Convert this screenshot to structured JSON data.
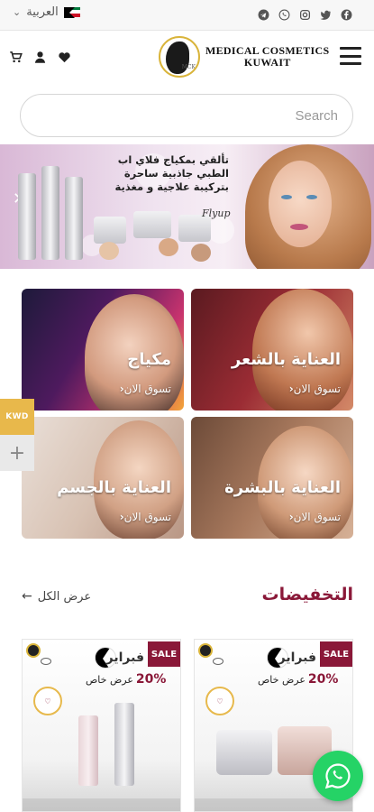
{
  "topbar": {
    "language_label": "العربية",
    "social_icons": [
      "facebook-icon",
      "twitter-icon",
      "instagram-icon",
      "whatsapp-icon",
      "telegram-icon"
    ]
  },
  "header": {
    "logo_line1": "MEDICAL COSMETICS",
    "logo_line2": "KUWAIT",
    "logo_mark_text": "MCK"
  },
  "search": {
    "placeholder": "Search"
  },
  "banner": {
    "text": "تألقي بمكياج فلاي اب الطبي جاذبية ساحرة بتركيبة علاجية و مغذية",
    "signature": "Flyup"
  },
  "categories": [
    {
      "title": "العناية بالشعر",
      "cta": "تسوق الان"
    },
    {
      "title": "مكياج",
      "cta": "تسوق الان"
    },
    {
      "title": "العناية بالبشرة",
      "cta": "تسوق الان"
    },
    {
      "title": "العناية بالجسم",
      "cta": "تسوق الان"
    }
  ],
  "currency": {
    "label": "KWD",
    "add_label": "+"
  },
  "sale_section": {
    "title": "التخفيضات",
    "view_all": "عرض الكل"
  },
  "products": [
    {
      "badge": "SALE",
      "month": "فبراير",
      "offer": "عرض خاص",
      "percent": "20%"
    },
    {
      "badge": "SALE",
      "month": "فبراير",
      "offer": "عرض خاص",
      "percent": "20%"
    }
  ],
  "colors": {
    "accent": "#8a1838",
    "gold": "#e8b84b",
    "whatsapp": "#25d366"
  }
}
